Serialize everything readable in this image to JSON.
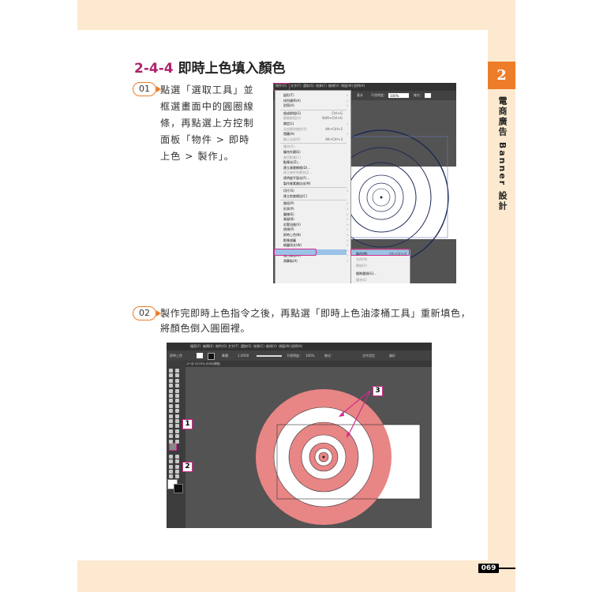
{
  "page": {
    "section_number": "2-4-4",
    "section_title": "即時上色填入顏色",
    "chapter_number": "2",
    "chapter_title": "電商廣告 Banner 設計",
    "page_number": "069"
  },
  "steps": [
    {
      "badge": "01",
      "text": "點選「選取工具」並框選畫面中的圓圈線條，再點選上方控制面板「物件 > 即時上色 > 製作」。"
    },
    {
      "badge": "02",
      "text": "製作完即時上色指令之後，再點選「即時上色油漆桶工具」重新填色，將顏色倒入圓圈裡。"
    }
  ],
  "screenshot1": {
    "menubar": [
      "物件(O)",
      "文字(T)",
      "選取(S)",
      "效果(C)",
      "檢視(V)",
      "視窗(W)",
      "說明(H)"
    ],
    "control": {
      "label1": "基本",
      "label2": "不透明度：",
      "opacity": "100%",
      "label3": "樣式："
    },
    "menu_items": [
      {
        "label": "變形(T)",
        "shortcut": "",
        "sub": true,
        "dim": false
      },
      {
        "label": "排列順序(A)",
        "shortcut": "",
        "sub": true,
        "dim": false
      },
      {
        "label": "對齊(A)",
        "shortcut": "",
        "sub": true,
        "dim": false
      },
      {
        "label": "組成群組(G)",
        "shortcut": "Ctrl+G",
        "sub": false,
        "dim": false
      },
      {
        "label": "解散群組(U)",
        "shortcut": "Shift+Ctrl+G",
        "sub": false,
        "dim": true
      },
      {
        "label": "鎖定(L)",
        "shortcut": "",
        "sub": true,
        "dim": false
      },
      {
        "label": "全部解除鎖定(K)",
        "shortcut": "Alt+Ctrl+2",
        "sub": false,
        "dim": true
      },
      {
        "label": "隱藏(H)",
        "shortcut": "",
        "sub": true,
        "dim": false
      },
      {
        "label": "顯示全部(K)",
        "shortcut": "Alt+Ctrl+3",
        "sub": false,
        "dim": true
      },
      {
        "label": "擴充(X)...",
        "shortcut": "",
        "sub": false,
        "dim": true
      },
      {
        "label": "擴充外觀(E)",
        "shortcut": "",
        "sub": false,
        "dim": false
      },
      {
        "label": "裁切影像(C)",
        "shortcut": "",
        "sub": false,
        "dim": true
      },
      {
        "label": "點陣化(Z)...",
        "shortcut": "",
        "sub": false,
        "dim": false
      },
      {
        "label": "建立漸層網格(D)...",
        "shortcut": "",
        "sub": false,
        "dim": false
      },
      {
        "label": "建立物件馬賽克(J)...",
        "shortcut": "",
        "sub": false,
        "dim": true
      },
      {
        "label": "透明度平面化(F)...",
        "shortcut": "",
        "sub": false,
        "dim": false
      },
      {
        "label": "製作像素最佳化(M)",
        "shortcut": "",
        "sub": false,
        "dim": false
      },
      {
        "label": "切片(S)",
        "shortcut": "",
        "sub": true,
        "dim": false
      },
      {
        "label": "建立剪裁標記(C)",
        "shortcut": "",
        "sub": false,
        "dim": false
      },
      {
        "label": "路徑(P)",
        "shortcut": "",
        "sub": true,
        "dim": false
      },
      {
        "label": "形狀(P)",
        "shortcut": "",
        "sub": true,
        "dim": false
      },
      {
        "label": "圖樣(E)",
        "shortcut": "",
        "sub": true,
        "dim": false
      },
      {
        "label": "漸變(B)",
        "shortcut": "",
        "sub": true,
        "dim": false
      },
      {
        "label": "封套扭曲(V)",
        "shortcut": "",
        "sub": true,
        "dim": false
      },
      {
        "label": "透視(P)",
        "shortcut": "",
        "sub": true,
        "dim": false
      },
      {
        "label": "即時上色(N)",
        "shortcut": "",
        "sub": true,
        "dim": false
      },
      {
        "label": "影像描圖",
        "shortcut": "",
        "sub": true,
        "dim": false
      },
      {
        "label": "繞圖排文(W)",
        "shortcut": "",
        "sub": true,
        "dim": false
      },
      {
        "label": "剪裁遮色片(M)",
        "shortcut": "",
        "sub": true,
        "dim": false
      },
      {
        "label": "複合路徑(O)",
        "shortcut": "",
        "sub": true,
        "dim": false
      },
      {
        "label": "演算板(A)",
        "shortcut": "",
        "sub": true,
        "dim": false
      }
    ],
    "submenu": [
      {
        "label": "製作(M)",
        "shortcut": "Alt+Ctrl+X",
        "dim": false
      },
      {
        "label": "合併(M)",
        "shortcut": "",
        "dim": true
      },
      {
        "label": "釋放(R)",
        "shortcut": "",
        "dim": true
      },
      {
        "label": "間隙選項(G)...",
        "shortcut": "",
        "dim": false
      },
      {
        "label": "擴充(E)",
        "shortcut": "",
        "dim": true
      }
    ]
  },
  "screenshot2": {
    "menubar": [
      "檔案(F)",
      "編輯(E)",
      "物件(O)",
      "文字(T)",
      "選取(S)",
      "效果(C)",
      "檢視(V)",
      "視窗(W)",
      "說明(H)"
    ],
    "control": {
      "mode": "即時上色",
      "stroke_label": "筆畫：",
      "stroke_value": "1.0058",
      "opacity_label": "不透明度：",
      "opacity": "100%",
      "style_label": "樣式：",
      "doc_setup": "文件設定",
      "prefs": "偏好"
    },
    "doc_tab": "未命名-2* @ 33.33% (RGB/預覽)",
    "badges": [
      "1",
      "2",
      "3"
    ],
    "fill_color": "#e88585"
  },
  "colors": {
    "accent_orange": "#ee7d2a",
    "magenta": "#b0236d",
    "highlight_pink": "#d22c8c",
    "peach": "#fde9cf"
  }
}
